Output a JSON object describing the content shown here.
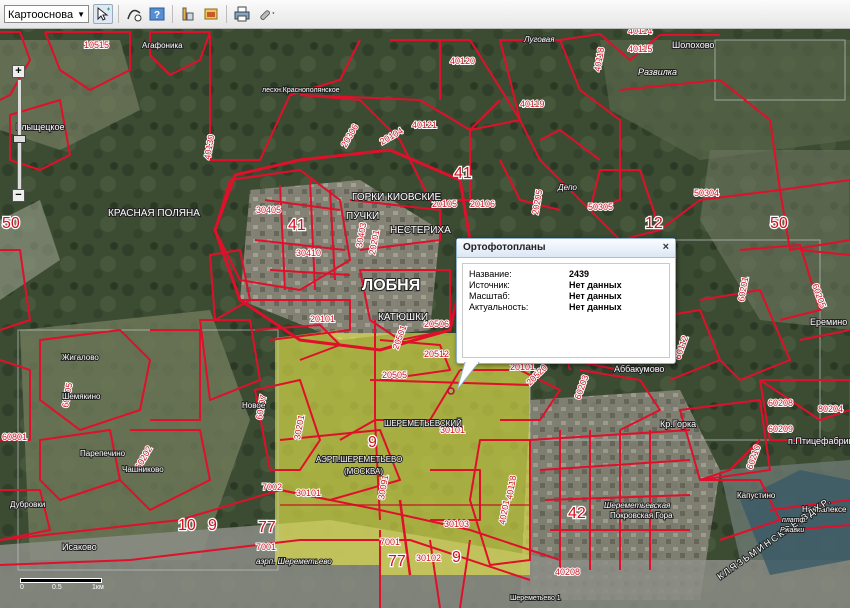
{
  "toolbar": {
    "basemap_select": "Картооснова",
    "buttons": [
      "pointer-tool-icon",
      "pan-info-icon",
      "help-icon",
      "measure-icon",
      "layers-icon",
      "print-icon",
      "link-icon"
    ]
  },
  "popup": {
    "title": "Ортофотопланы",
    "close": "×",
    "rows": [
      {
        "label": "Название:",
        "value": "2439"
      },
      {
        "label": "Источник:",
        "value": "Нет данных"
      },
      {
        "label": "Масштаб:",
        "value": "Нет данных"
      },
      {
        "label": "Актуальность:",
        "value": "Нет данных"
      }
    ]
  },
  "map_labels": {
    "lobnya": "ЛОБНЯ",
    "gorki": "ГОРКИ КИОВСКИЕ",
    "puchki": "ПУЧКИ",
    "nesterikha": "НЕСТЕРИХА",
    "katyushki": "КАТЮШКИ",
    "krasnaya_polyana": "КРАСНАЯ ПОЛЯНА",
    "leschin": "лесхн.Краснополянское",
    "sheremetyevsky": "ШЕРЕМЕТЬЕВСКИЙ",
    "aerp_sher": "АЭРП.ШЕРЕМЕТЬЕВО",
    "moskva": "(МОСКВА)",
    "aerp_small": "аэрп. Шереметьево",
    "abbakumovo": "Аббакумово",
    "krgorka": "Кр.Горка",
    "ptitsefabrika": "п.Птицефабрик",
    "eremino": "Еремино",
    "sholokhovo": "Шолохово",
    "razvilka": "Развилка",
    "lugovaya": "Луговая",
    "agafonika": "Агафоника",
    "klyshcheckoe": "Клыщецкое",
    "zhigalovo": "Жигалово",
    "shemyakino": "Шемякино",
    "parepechino": "Парепечино",
    "chashnikovo": "Чашниково",
    "novoe": "Новое",
    "dubrovki": "Дубровки",
    "isakovo": "Исаково",
    "kapustino": "Капустино",
    "novoalekseevka": "Новоалексе",
    "pokrovskaya": "Покровская Гора",
    "sheremetevskaya": "Шереметьевская",
    "klyazminskoe": "КЛЯЗЬМИНСКОЕ ВДХР.",
    "depo": "Депо",
    "platf": "платф.",
    "rzhavki": "Ржавки",
    "sheremetyevo1": "Шереметьево 1"
  },
  "parcel_numbers": [
    "40120",
    "40119",
    "40121",
    "40118",
    "40114",
    "40115",
    "50304",
    "50305",
    "20104",
    "20105",
    "20106",
    "20205",
    "20306",
    "20501",
    "20505",
    "20506",
    "20512",
    "20520",
    "30405",
    "30410",
    "30101",
    "30102",
    "30103",
    "30091",
    "40118",
    "40201",
    "40208",
    "60203",
    "60208",
    "60209",
    "60210",
    "60112",
    "60107",
    "60801",
    "60705",
    "40130",
    "20101",
    "30201",
    "30403",
    "20201",
    "10515",
    "20101",
    "80204",
    "60205",
    "60202",
    "60201"
  ],
  "big_numbers": {
    "n41a": "41",
    "n41b": "41",
    "n50": "50",
    "n12": "12",
    "n50left": "50",
    "n77a": "77",
    "n77b": "77",
    "n42": "42",
    "n9a": "9",
    "n9b": "9",
    "n9c": "9",
    "n10": "10",
    "n7002": "7002",
    "n7001a": "7001",
    "n7001b": "7001",
    "n30101": "30101"
  },
  "zoom": {
    "plus": "+",
    "minus": "−"
  },
  "scale": {
    "zero": "0",
    "half": "0.5",
    "one": "1км"
  },
  "colors": {
    "parcel_line": "#e0102a",
    "highlight": "#e8e84a",
    "popup_border": "#8fb0d0"
  }
}
